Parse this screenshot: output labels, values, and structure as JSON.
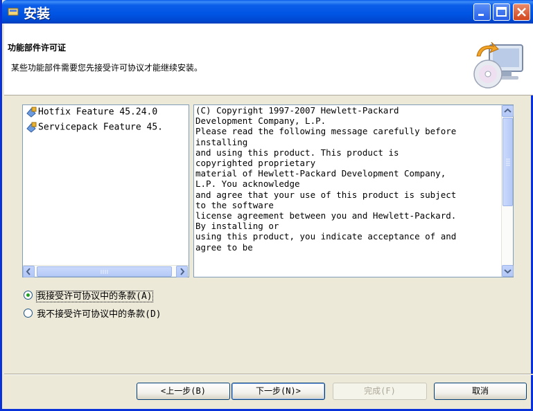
{
  "window": {
    "title": "安装"
  },
  "header": {
    "title": "功能部件许可证",
    "description": "某些功能部件需要您先接受许可协议才能继续安装。"
  },
  "features": [
    {
      "label": "Hotfix Feature 45.24.0"
    },
    {
      "label": "Servicepack Feature 45."
    }
  ],
  "license_text": "(C) Copyright 1997-2007 Hewlett-Packard\nDevelopment Company, L.P.\nPlease read the following message carefully before\ninstalling\nand using this product. This product is\ncopyrighted proprietary\nmaterial of Hewlett-Packard Development Company,\nL.P. You acknowledge\nand agree that your use of this product is subject\nto the software\nlicense agreement between you and Hewlett-Packard.\nBy installing or\nusing this product, you indicate acceptance of and\nagree to be",
  "options": {
    "accept": {
      "label": "我接受许可协议中的条款(A)",
      "selected": true
    },
    "decline": {
      "label": "我不接受许可协议中的条款(D)",
      "selected": false
    }
  },
  "buttons": {
    "back": "<上一步(B)",
    "next": "下一步(N)>",
    "finish": "完成(F)",
    "cancel": "取消"
  },
  "colors": {
    "titlebar": "#0054e3",
    "accent_green": "#21a121",
    "dialog_bg": "#ece9d8"
  }
}
